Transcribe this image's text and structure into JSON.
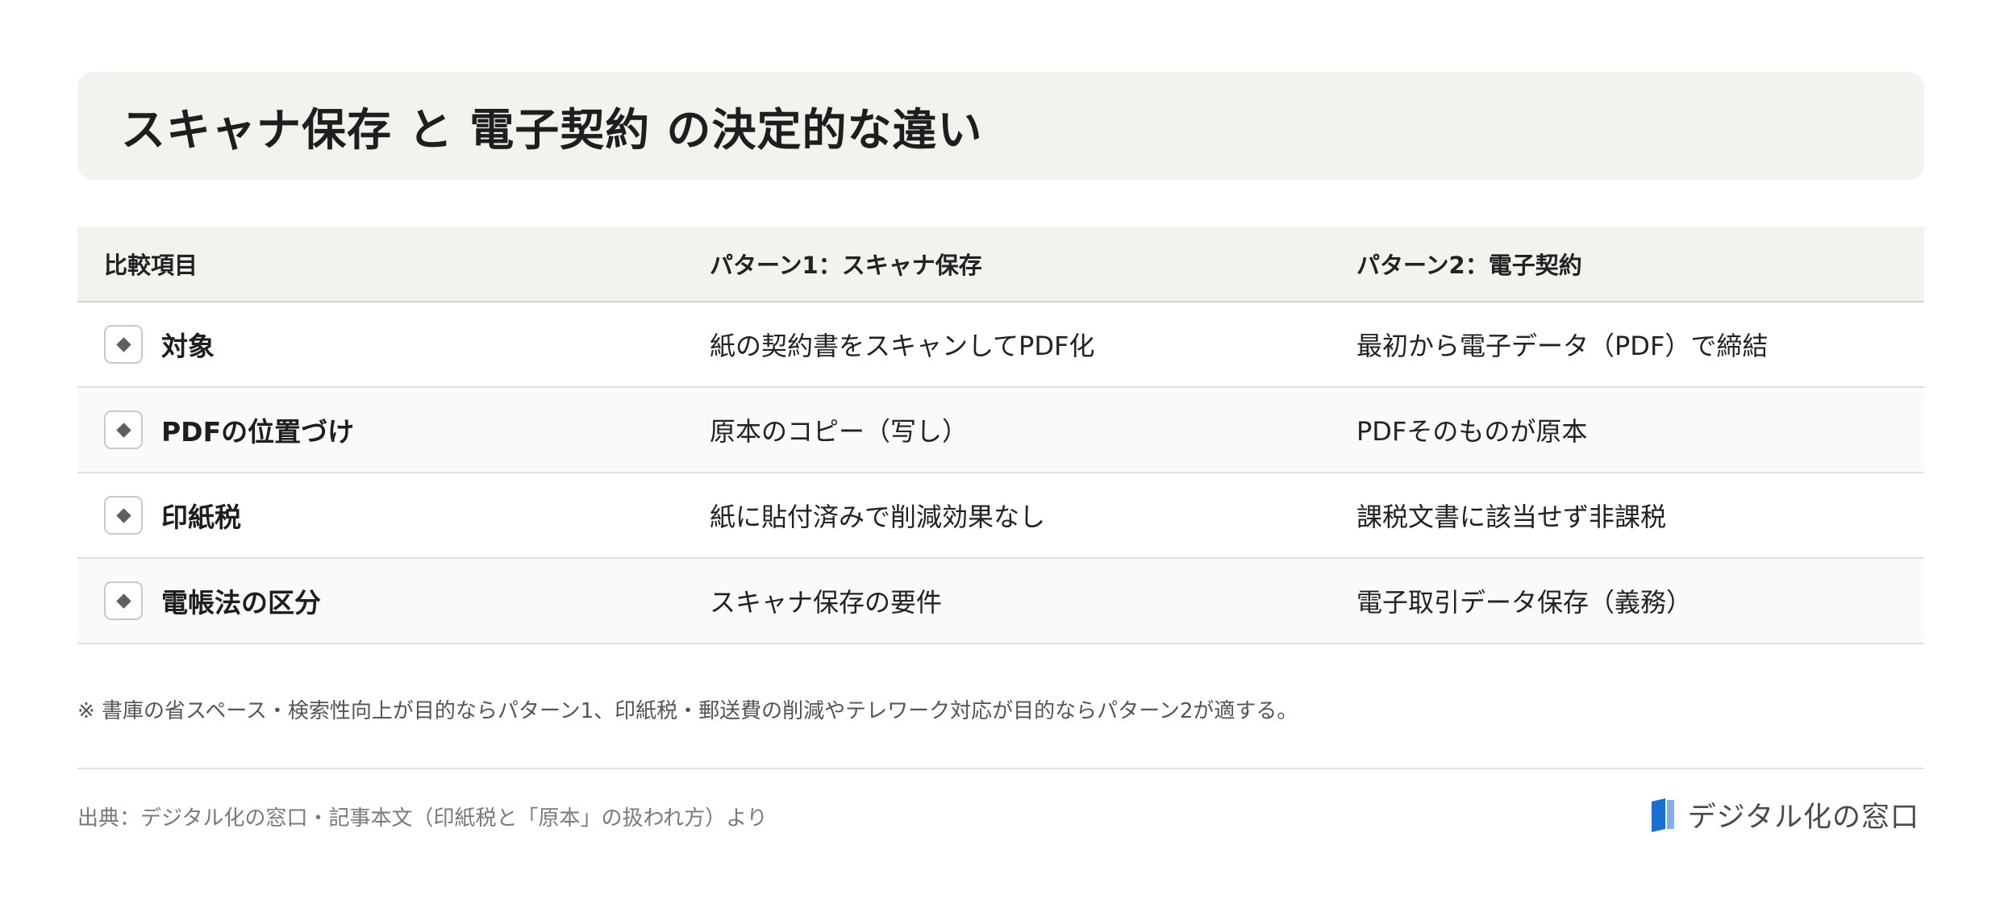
{
  "title": "スキャナ保存 と 電子契約 の決定的な違い",
  "table": {
    "headers": [
      "比較項目",
      "パターン1：スキャナ保存",
      "パターン2：電子契約"
    ],
    "rows": [
      {
        "item": "対象",
        "pattern1": "紙の契約書をスキャンしてPDF化",
        "pattern2": "最初から電子データ（PDF）で締結"
      },
      {
        "item": "PDFの位置づけ",
        "pattern1": "原本のコピー（写し）",
        "pattern2": "PDFそのものが原本"
      },
      {
        "item": "印紙税",
        "pattern1": "紙に貼付済みで削減効果なし",
        "pattern2": "課税文書に該当せず非課税"
      },
      {
        "item": "電帳法の区分",
        "pattern1": "スキャナ保存の要件",
        "pattern2": "電子取引データ保存（義務）"
      }
    ]
  },
  "note": "※ 書庫の省スペース・検索性向上が目的ならパターン1、印紙税・郵送費の削減やテレワーク対応が目的ならパターン2が適する。",
  "source": "出典：デジタル化の窓口・記事本文（印紙税と「原本」の扱われ方）より",
  "logo": {
    "text": "デジタル化の窓口",
    "icon": "book-logo-icon",
    "color": "#1a6fd1"
  },
  "colors": {
    "header_bg": "#f4f2ec",
    "marker": "#5a5f63"
  }
}
